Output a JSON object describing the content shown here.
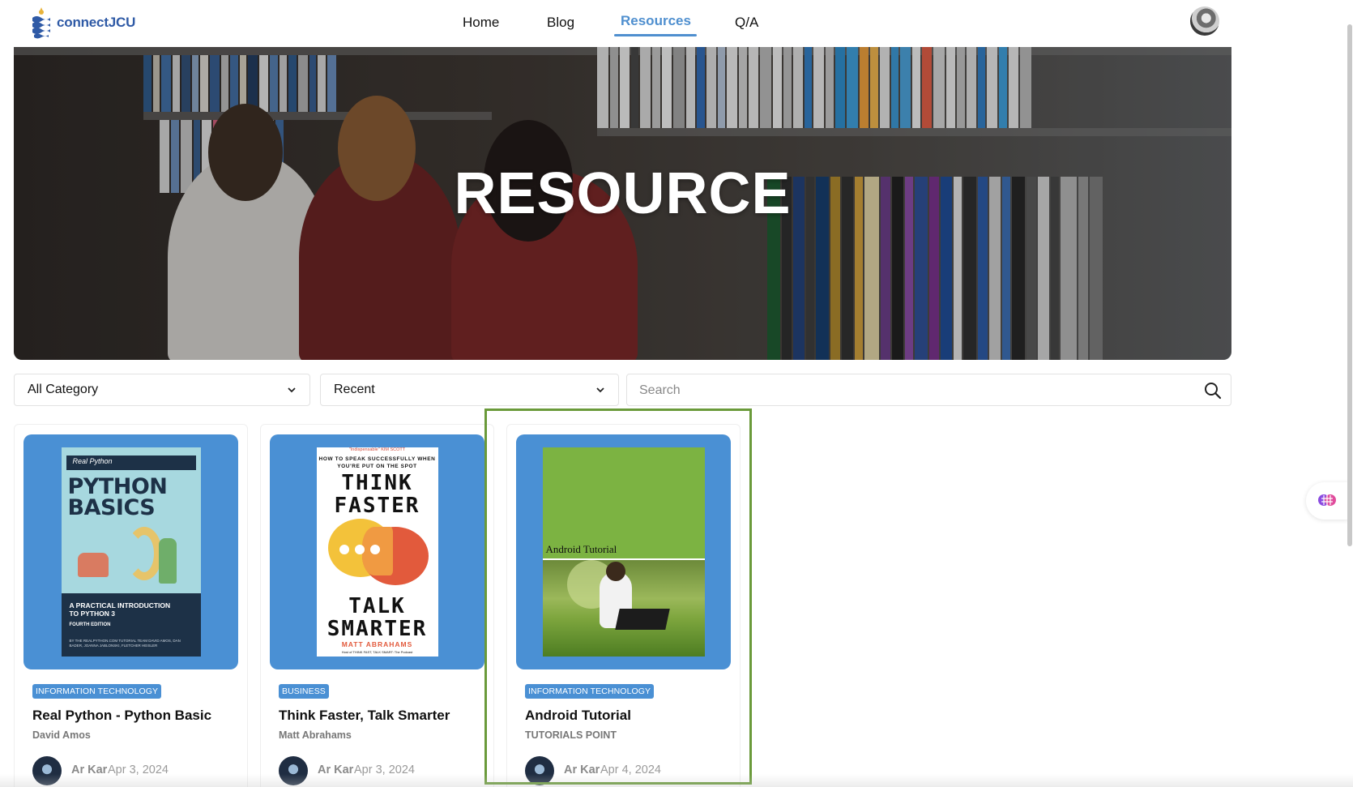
{
  "header": {
    "logo_text": "connectJCU",
    "nav": {
      "home": "Home",
      "blog": "Blog",
      "resources": "Resources",
      "qa": "Q/A"
    }
  },
  "hero": {
    "title": "RESOURCE"
  },
  "filters": {
    "category": "All Category",
    "sort": "Recent",
    "search_placeholder": "Search"
  },
  "cards": [
    {
      "category": "INFORMATION TECHNOLOGY",
      "title": "Real Python - Python Basic",
      "author": "David Amos",
      "user": "Ar Kar",
      "date": "Apr 3, 2024",
      "cover": {
        "brand": "Real Python",
        "title": "PYTHON BASICS",
        "subtitle": "A PRACTICAL INTRODUCTION TO PYTHON 3",
        "edition": "FOURTH EDITION",
        "credits": "BY THE REALPYTHON.COM TUTORIAL TEAM DAVID AMOS, DAN BADER, JOANNA JABLONSKI, FLETCHER HEISLER"
      }
    },
    {
      "category": "BUSINESS",
      "title": "Think Faster, Talk Smarter",
      "author": "Matt Abrahams",
      "user": "Ar Kar",
      "date": "Apr 3, 2024",
      "cover": {
        "blurb": "\"Indispensable\" KIM SCOTT",
        "subtitle": "HOW TO SPEAK SUCCESSFULLY WHEN YOU'RE PUT ON THE SPOT",
        "title_top": "THINK FASTER",
        "title_bottom": "TALK SMARTER",
        "author": "MATT ABRAHAMS",
        "host": "Host of THINK FAST, TALK SMART: The Podcast"
      }
    },
    {
      "category": "INFORMATION TECHNOLOGY",
      "title": "Android Tutorial",
      "author": "TUTORIALS POINT",
      "user": "Ar Kar",
      "date": "Apr 4, 2024",
      "cover": {
        "label": "Android Tutorial"
      }
    }
  ],
  "colors": {
    "accent": "#4f8fcf",
    "card_cover_bg": "#4a90d4",
    "highlight_border": "#6a9a3a"
  },
  "icons": {
    "logo": "jcu-waves-logo-icon",
    "profile": "user-avatar-icon",
    "chevron": "chevron-down-icon",
    "search": "search-icon",
    "assistant": "brain-icon"
  }
}
